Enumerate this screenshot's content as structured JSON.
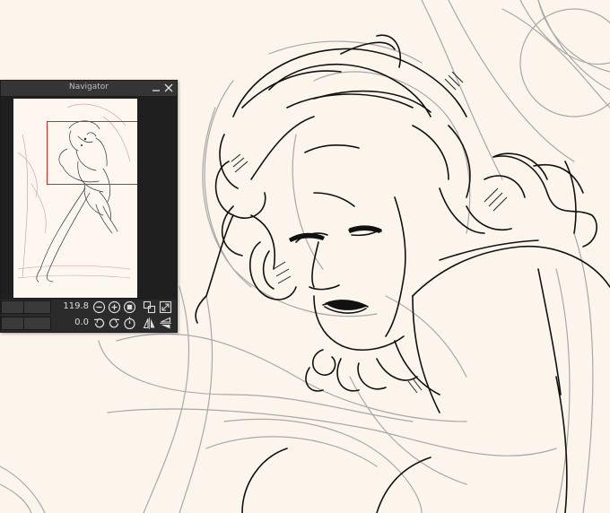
{
  "navigator": {
    "title": "Navigator",
    "zoom_value": "119.8",
    "rotation_value": "0.0"
  },
  "icons": {
    "minimize": "minimize-icon",
    "close": "close-icon",
    "zoom_out": "zoom-out-icon",
    "zoom_in": "zoom-in-icon",
    "fit": "fit-screen-icon",
    "actual_size": "actual-size-icon",
    "fullscreen": "expand-icon",
    "rotate_left": "rotate-left-icon",
    "rotate_right": "rotate-right-icon",
    "reset_rotation": "reset-rotation-icon",
    "flip_horizontal": "flip-horizontal-icon",
    "flip_vertical": "flip-vertical-icon"
  },
  "colors": {
    "canvas": "#fcf5ec",
    "panel": "#2b2b2b",
    "view_rect": "#e02424"
  }
}
